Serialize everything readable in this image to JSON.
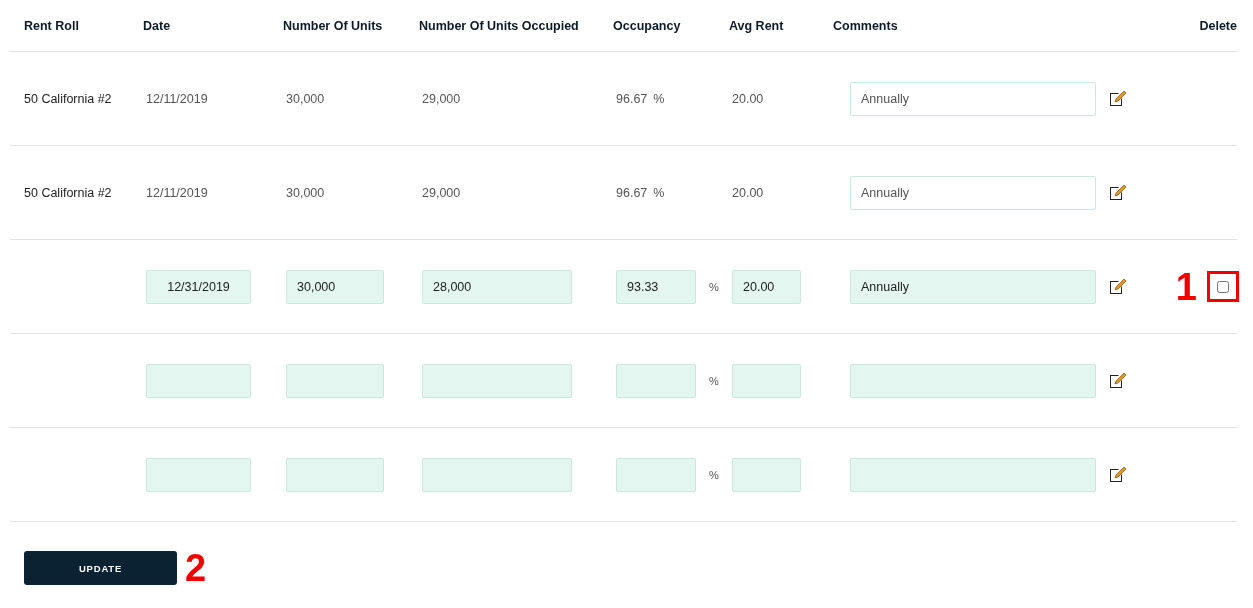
{
  "columns": [
    "Rent Roll",
    "Date",
    "Number Of Units",
    "Number Of Units Occupied",
    "Occupancy",
    "Avg Rent",
    "Comments",
    "",
    "Delete"
  ],
  "rows": [
    {
      "kind": "display",
      "rent_roll": "50 California #2",
      "date": "12/11/2019",
      "units": "30,000",
      "occupied": "29,000",
      "occupancy": "96.67",
      "percent": "%",
      "avg_rent": "20.00",
      "comment": "Annually"
    },
    {
      "kind": "display",
      "rent_roll": "50 California #2",
      "date": "12/11/2019",
      "units": "30,000",
      "occupied": "29,000",
      "occupancy": "96.67",
      "percent": "%",
      "avg_rent": "20.00",
      "comment": "Annually"
    },
    {
      "kind": "edit",
      "date": "12/31/2019",
      "units": "30,000",
      "occupied": "28,000",
      "occupancy": "93.33",
      "percent": "%",
      "avg_rent": "20.00",
      "comment": "Annually",
      "delete": {
        "checked": false
      },
      "callout": "1"
    },
    {
      "kind": "edit",
      "percent": "%"
    },
    {
      "kind": "edit",
      "percent": "%"
    }
  ],
  "update_button": {
    "label": "UPDATE",
    "callout": "2"
  }
}
